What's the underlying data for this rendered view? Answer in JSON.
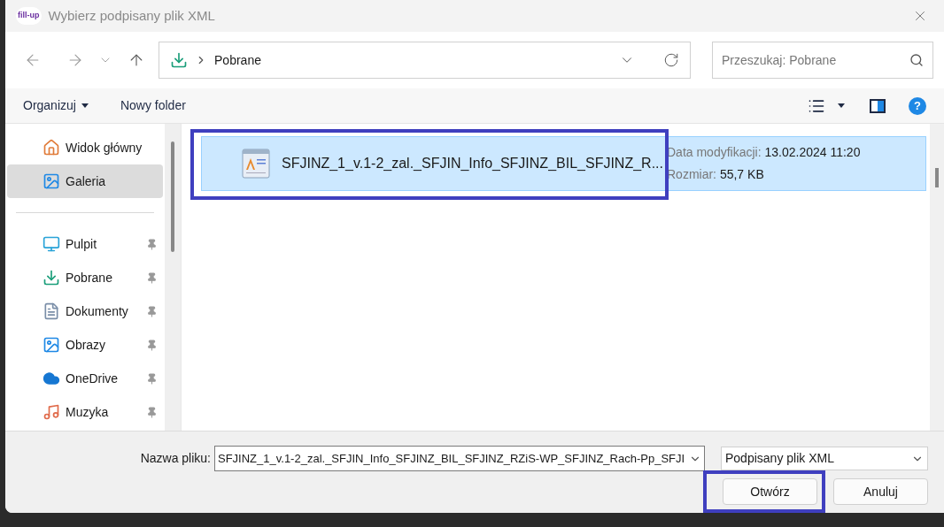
{
  "window": {
    "title": "Wybierz podpisany plik XML",
    "app_logo": "fill-up"
  },
  "address": {
    "segment": "Pobrane"
  },
  "search": {
    "placeholder": "Przeszukaj: Pobrane"
  },
  "toolbar": {
    "organize": "Organizuj",
    "new_folder": "Nowy folder",
    "help": "?"
  },
  "sidebar": {
    "items": [
      {
        "kind": "home",
        "label": "Widok główny",
        "selected": false,
        "pinned": false
      },
      {
        "kind": "gallery",
        "label": "Galeria",
        "selected": true,
        "pinned": false
      },
      {
        "kind": "desktop",
        "label": "Pulpit",
        "selected": false,
        "pinned": true
      },
      {
        "kind": "download",
        "label": "Pobrane",
        "selected": false,
        "pinned": true
      },
      {
        "kind": "documents",
        "label": "Dokumenty",
        "selected": false,
        "pinned": true
      },
      {
        "kind": "pictures",
        "label": "Obrazy",
        "selected": false,
        "pinned": true
      },
      {
        "kind": "cloud",
        "label": "OneDrive",
        "selected": false,
        "pinned": true
      },
      {
        "kind": "music",
        "label": "Muzyka",
        "selected": false,
        "pinned": true
      }
    ]
  },
  "files": [
    {
      "name": "SFJINZ_1_v.1-2_zal._SFJIN_Info_SFJINZ_BIL_SFJINZ_R...",
      "date_label": "Data modyfikacji:",
      "date": "13.02.2024 11:20",
      "size_label": "Rozmiar:",
      "size": "55,7 KB",
      "selected": true
    }
  ],
  "footer": {
    "filename_label": "Nazwa pliku:",
    "filename": "SFJINZ_1_v.1-2_zal._SFJIN_Info_SFJINZ_BIL_SFJINZ_RZiS-WP_SFJINZ_Rach-Pp_SFJI",
    "filter": "Podpisany plik XML",
    "open": "Otwórz",
    "cancel": "Anuluj"
  }
}
